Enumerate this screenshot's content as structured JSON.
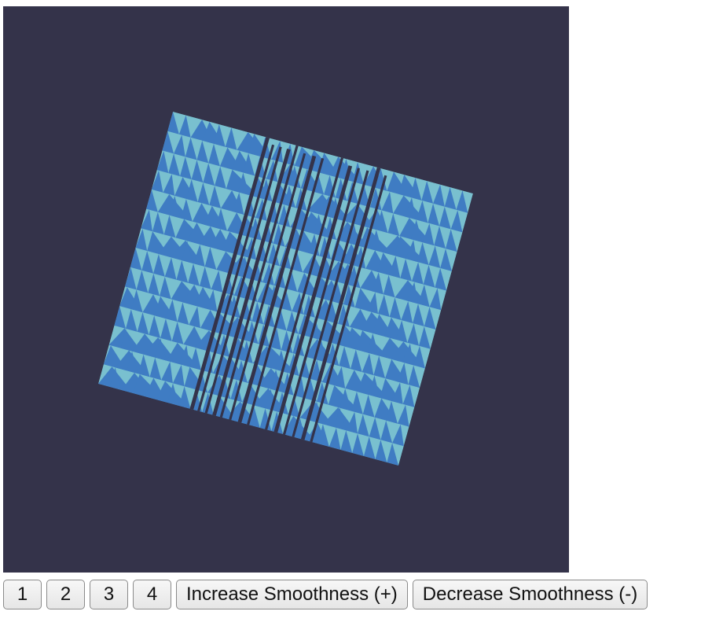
{
  "viewport": {
    "background_color": "#34334a",
    "mesh_light_color": "#79c0cf",
    "mesh_dark_color": "#3f7cc3",
    "content": "rotated rippled plane mesh"
  },
  "controls": {
    "buttons": [
      {
        "label": "1",
        "name": "mode-1-button"
      },
      {
        "label": "2",
        "name": "mode-2-button"
      },
      {
        "label": "3",
        "name": "mode-3-button"
      },
      {
        "label": "4",
        "name": "mode-4-button"
      },
      {
        "label": "Increase Smoothness (+)",
        "name": "increase-smoothness-button"
      },
      {
        "label": "Decrease Smoothness (-)",
        "name": "decrease-smoothness-button"
      }
    ]
  }
}
